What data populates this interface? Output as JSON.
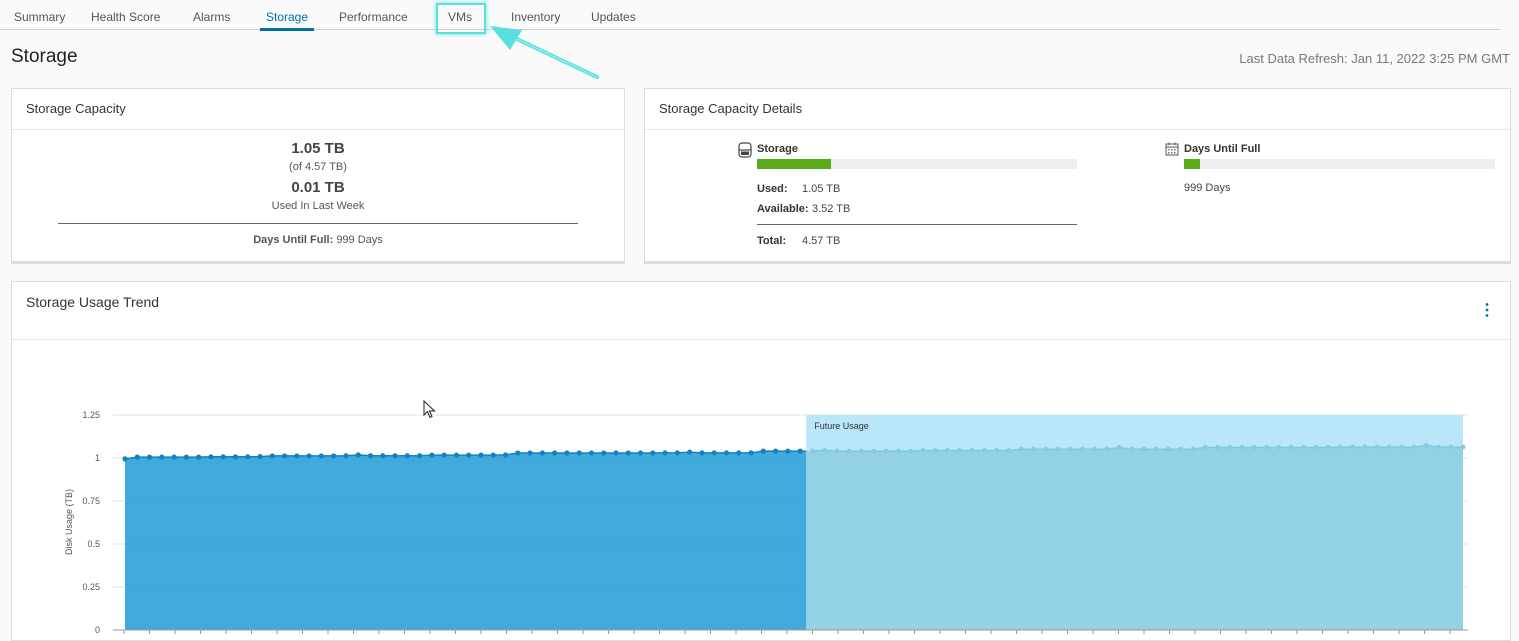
{
  "tabs": [
    {
      "label": "Summary",
      "name": "tab-summary"
    },
    {
      "label": "Health Score",
      "name": "tab-health-score"
    },
    {
      "label": "Alarms",
      "name": "tab-alarms"
    },
    {
      "label": "Storage",
      "name": "tab-storage"
    },
    {
      "label": "Performance",
      "name": "tab-performance"
    },
    {
      "label": "VMs",
      "name": "tab-vms"
    },
    {
      "label": "Inventory",
      "name": "tab-inventory"
    },
    {
      "label": "Updates",
      "name": "tab-updates"
    }
  ],
  "active_tab": "Storage",
  "page": {
    "title": "Storage",
    "last_refresh": "Last Data Refresh: Jan 11, 2022 3:25 PM GMT"
  },
  "capacity": {
    "title": "Storage Capacity",
    "used": "1.05 TB",
    "of_total": "(of 4.57 TB)",
    "weekly": "0.01 TB",
    "weekly_label": "Used In Last Week",
    "days_label": "Days Until Full:",
    "days_value": "999 Days"
  },
  "details": {
    "title": "Storage Capacity Details",
    "storage_label": "Storage",
    "storage_fraction": 0.23,
    "used_label": "Used:",
    "used_value": "1.05 TB",
    "available_label": "Available:",
    "available_value": "3.52 TB",
    "total_label": "Total:",
    "total_value": "4.57 TB",
    "days_label": "Days Until Full",
    "days_fraction": 0.05,
    "days_value": "999 Days",
    "bar_color": "#5aaa19",
    "storage_icon": "database-icon",
    "days_icon": "calendar-icon"
  },
  "trend": {
    "title": "Storage Usage Trend",
    "menu_icon": "more-vertical-icon"
  },
  "chart_data": {
    "type": "area",
    "ylabel": "Disk Usage (TB)",
    "ylim": [
      0,
      1.25
    ],
    "yticks": [
      {
        "v": 0,
        "label": "0"
      },
      {
        "v": 0.25,
        "label": "0.25"
      },
      {
        "v": 0.5,
        "label": "0.5"
      },
      {
        "v": 0.75,
        "label": "0.75"
      },
      {
        "v": 1,
        "label": "1"
      },
      {
        "v": 1.25,
        "label": "1.25"
      }
    ],
    "future_label": "Future Usage",
    "grid": true,
    "series": [
      {
        "values": [
          0.995,
          1.005,
          1.005,
          1.005,
          1.005,
          1.005,
          1.005,
          1.007,
          1.007,
          1.007,
          1.007,
          1.008,
          1.012,
          1.012,
          1.012,
          1.012,
          1.012,
          1.012,
          1.013,
          1.018,
          1.013,
          1.013,
          1.013,
          1.013,
          1.013,
          1.017,
          1.017,
          1.017,
          1.017,
          1.017,
          1.017,
          1.018,
          1.029,
          1.029,
          1.029,
          1.029,
          1.029,
          1.029,
          1.029,
          1.029,
          1.029,
          1.029,
          1.029,
          1.029,
          1.03,
          1.03,
          1.034,
          1.03,
          1.03,
          1.03,
          1.03,
          1.03,
          1.04,
          1.04,
          1.04,
          1.04
        ],
        "color": "#1e9bd7"
      },
      {
        "values": [
          1.04,
          1.04,
          1.045,
          1.04,
          1.04,
          1.04,
          1.04,
          1.04,
          1.04,
          1.04,
          1.044,
          1.044,
          1.044,
          1.044,
          1.044,
          1.044,
          1.044,
          1.044,
          1.052,
          1.052,
          1.052,
          1.052,
          1.052,
          1.052,
          1.052,
          1.052,
          1.062,
          1.052,
          1.052,
          1.052,
          1.052,
          1.052,
          1.052,
          1.062,
          1.062,
          1.062,
          1.062,
          1.062,
          1.062,
          1.062,
          1.062,
          1.062,
          1.062,
          1.062,
          1.064,
          1.064,
          1.064,
          1.064,
          1.064,
          1.064,
          1.064,
          1.074,
          1.064,
          1.064,
          1.064
        ],
        "color": "#93d2e5"
      }
    ]
  },
  "colors": {
    "accent": "#0072a3",
    "highlight": "#58e0dc"
  }
}
